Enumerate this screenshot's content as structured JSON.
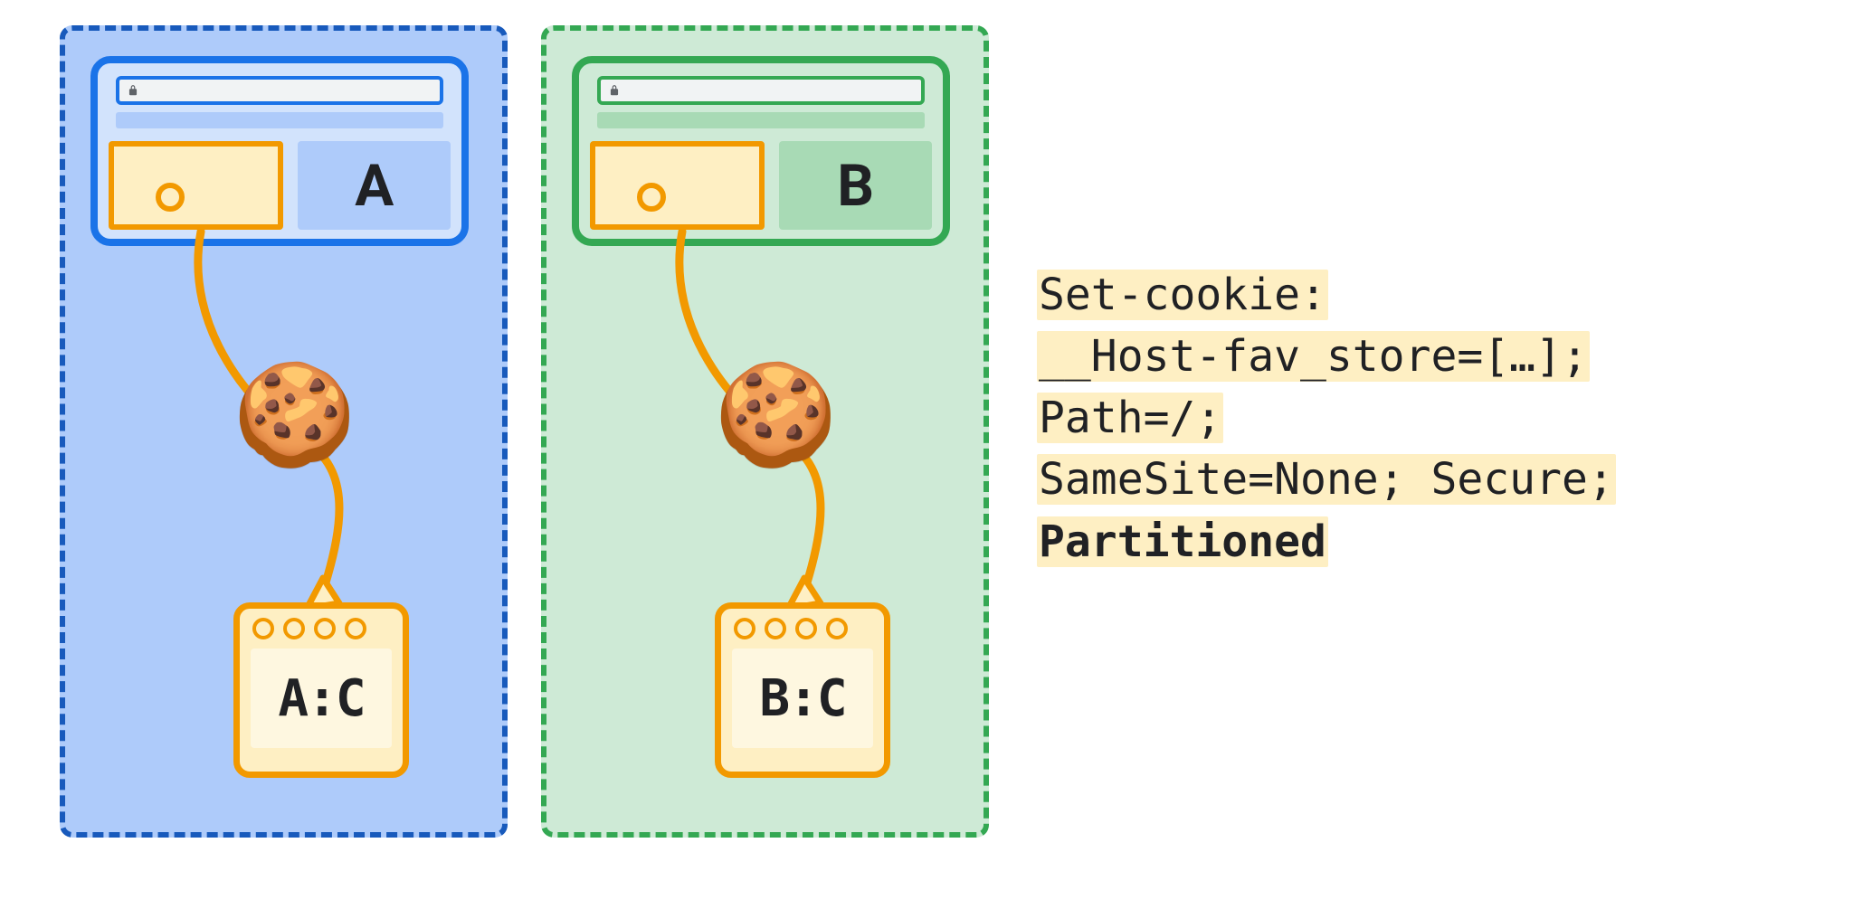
{
  "panels": {
    "blue": {
      "site": "A",
      "jar": "A:C"
    },
    "green": {
      "site": "B",
      "jar": "B:C"
    }
  },
  "cookie_icon": "🍪",
  "code": {
    "l1": "Set-cookie:",
    "l2": "__Host-fav_store=[…];",
    "l3": "Path=/;",
    "l4": "SameSite=None; Secure;",
    "l5": "Partitioned"
  },
  "colors": {
    "blue_border": "#185abc",
    "blue_fill": "#aecbfa",
    "green_border": "#34a853",
    "green_fill": "#ceead6",
    "orange": "#f29900",
    "orange_fill": "#feefc3"
  }
}
